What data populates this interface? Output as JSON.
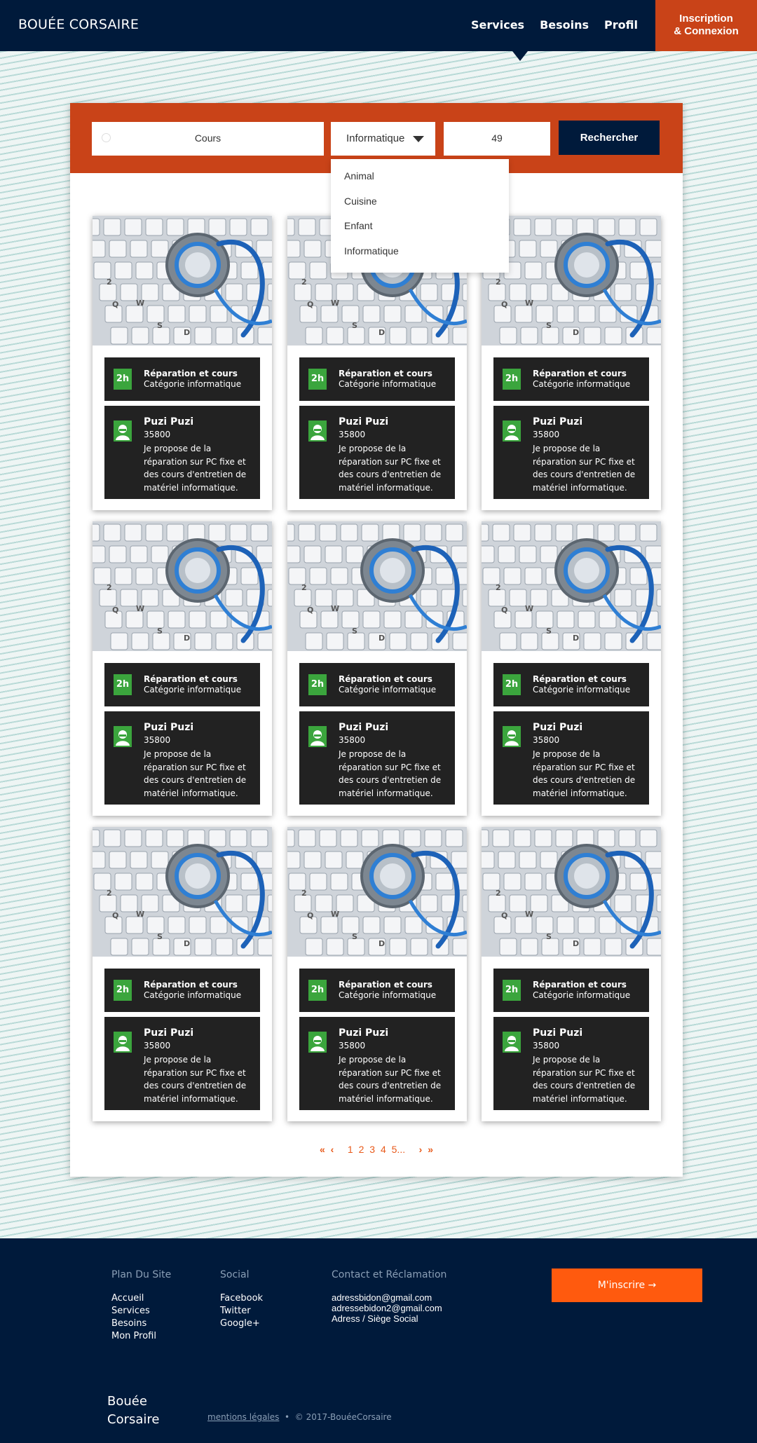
{
  "nav": {
    "brand": "BOUÉE CORSAIRE",
    "links": [
      "Services",
      "Besoins",
      "Profil"
    ],
    "login_line1": "Inscription",
    "login_line2": "& Connexion"
  },
  "search": {
    "query": "Cours",
    "category": "Informatique",
    "zip": "49",
    "button": "Rechercher",
    "options": [
      "Animal",
      "Cuisine",
      "Enfant",
      "Informatique"
    ]
  },
  "cards": [
    {
      "badge": "2h",
      "title": "Réparation et cours",
      "category": "Catégorie informatique",
      "name": "Puzi Puzi",
      "zip": "35800",
      "description": "Je propose de la réparation sur PC fixe et des cours d'entretien de matériel informatique."
    },
    {
      "badge": "2h",
      "title": "Réparation et cours",
      "category": "Catégorie informatique",
      "name": "Puzi Puzi",
      "zip": "35800",
      "description": "Je propose de la réparation sur PC fixe et des cours d'entretien de matériel informatique."
    },
    {
      "badge": "2h",
      "title": "Réparation et cours",
      "category": "Catégorie informatique",
      "name": "Puzi Puzi",
      "zip": "35800",
      "description": "Je propose de la réparation sur PC fixe et des cours d'entretien de matériel informatique."
    },
    {
      "badge": "2h",
      "title": "Réparation et cours",
      "category": "Catégorie informatique",
      "name": "Puzi Puzi",
      "zip": "35800",
      "description": "Je propose de la réparation sur PC fixe et des cours d'entretien de matériel informatique."
    },
    {
      "badge": "2h",
      "title": "Réparation et cours",
      "category": "Catégorie informatique",
      "name": "Puzi Puzi",
      "zip": "35800",
      "description": "Je propose de la réparation sur PC fixe et des cours d'entretien de matériel informatique."
    },
    {
      "badge": "2h",
      "title": "Réparation et cours",
      "category": "Catégorie informatique",
      "name": "Puzi Puzi",
      "zip": "35800",
      "description": "Je propose de la réparation sur PC fixe et des cours d'entretien de matériel informatique."
    },
    {
      "badge": "2h",
      "title": "Réparation et cours",
      "category": "Catégorie informatique",
      "name": "Puzi Puzi",
      "zip": "35800",
      "description": "Je propose de la réparation sur PC fixe et des cours d'entretien de matériel informatique."
    },
    {
      "badge": "2h",
      "title": "Réparation et cours",
      "category": "Catégorie informatique",
      "name": "Puzi Puzi",
      "zip": "35800",
      "description": "Je propose de la réparation sur PC fixe et des cours d'entretien de matériel informatique."
    },
    {
      "badge": "2h",
      "title": "Réparation et cours",
      "category": "Catégorie informatique",
      "name": "Puzi Puzi",
      "zip": "35800",
      "description": "Je propose de la réparation sur PC fixe et des cours d'entretien de matériel informatique."
    }
  ],
  "pagination": {
    "first": "«",
    "prev": "‹",
    "pages": [
      "1",
      "2",
      "3",
      "4",
      "5..."
    ],
    "next": "›",
    "last": "»"
  },
  "footer": {
    "sitemap_title": "Plan Du Site",
    "sitemap_links": [
      "Accueil",
      "Services",
      "Besoins",
      "Mon Profil"
    ],
    "social_title": "Social",
    "social_links": [
      "Facebook",
      "Twitter",
      "Google+"
    ],
    "contact_title": "Contact et Réclamation",
    "contact_lines": [
      "adressbidon@gmail.com",
      "adressebidon2@gmail.com",
      "Adress / Siège Social"
    ],
    "signup": "M'inscrire →",
    "brand_line1": "Bouée",
    "brand_line2": "Corsaire",
    "legal_link": "mentions légales",
    "copyright": "© 2017-BouéeCorsaire"
  },
  "colors": {
    "navy": "#001a3b",
    "orange": "#c94318",
    "accent_orange": "#ff5a0e",
    "green": "#3ba53d",
    "card_dark": "#222222"
  }
}
